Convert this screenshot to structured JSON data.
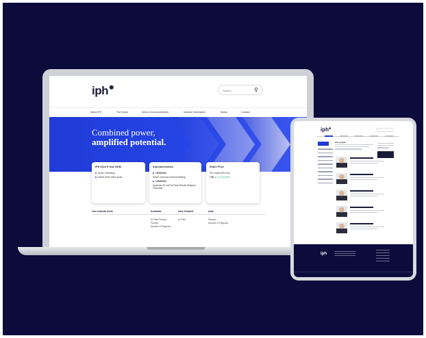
{
  "laptop": {
    "logo": "iph",
    "logo_sup": "✹",
    "search_placeholder": "Search",
    "nav": [
      "About IPH",
      "The Board",
      "News & Announcements",
      "Investor Information",
      "Media",
      "Contact"
    ],
    "hero": {
      "line1": "Combined power,",
      "line2": "amplified potential."
    },
    "cards": [
      {
        "title": "IPH 2024 5 Year NOM",
        "rows": [
          "Notice of Meeting",
          "Online AGM online guide"
        ]
      },
      {
        "title": "Announcements",
        "rows": [
          {
            "date": "14/08/2024",
            "text": "Notice of Annual General Meeting"
          },
          {
            "date": "14/08/2024",
            "text": "Appendix 4E and Full Year Results Statutory Financials"
          }
        ]
      },
      {
        "title": "Share Price",
        "line": "IPH Limited (IPH:AX)",
        "price": "7.06",
        "change": "▲ 0.24 (3.52%)"
      }
    ],
    "table": {
      "headers": [
        "Our network firms",
        "Australia",
        "New Zealand",
        "Asia"
      ],
      "australia": [
        "AJ Park Pizzeys",
        "Pizzeys",
        "Spruson & Ferguson"
      ],
      "new_zealand": [
        "AJ Park"
      ],
      "asia": [
        "Pizzeys",
        "Spruson & Ferguson"
      ]
    }
  },
  "tablet": {
    "logo": "iph",
    "logo_sup": "✹",
    "page_title": "Our people",
    "footer_logo": "iph"
  },
  "colors": {
    "background": "#0c0b3b",
    "brand_blue": "#1f3ad6",
    "positive": "#1fa88a"
  }
}
